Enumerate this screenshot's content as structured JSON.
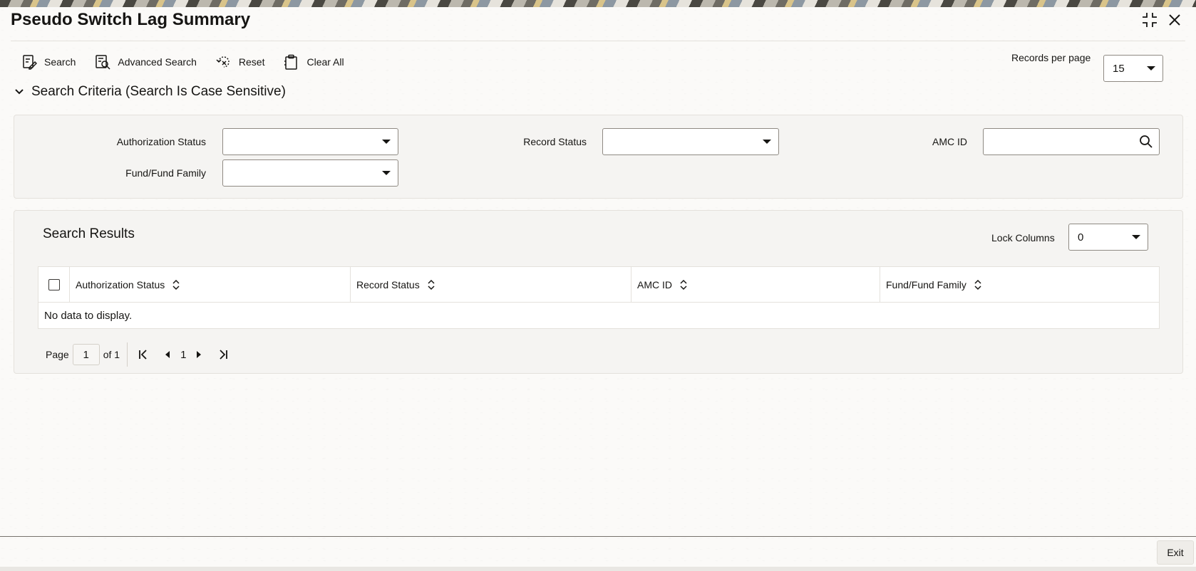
{
  "window": {
    "title": "Pseudo Switch Lag Summary"
  },
  "toolbar": {
    "search_label": "Search",
    "advanced_search_label": "Advanced Search",
    "reset_label": "Reset",
    "clear_all_label": "Clear All",
    "records_per_page_label": "Records per page",
    "records_per_page_value": "15"
  },
  "criteria": {
    "title": "Search Criteria (Search Is Case Sensitive)",
    "authorization_status_label": "Authorization Status",
    "authorization_status_value": "",
    "record_status_label": "Record Status",
    "record_status_value": "",
    "amc_id_label": "AMC ID",
    "amc_id_value": "",
    "fund_family_label": "Fund/Fund Family",
    "fund_family_value": ""
  },
  "results": {
    "title": "Search Results",
    "lock_columns_label": "Lock Columns",
    "lock_columns_value": "0",
    "columns": [
      "Authorization Status",
      "Record Status",
      "AMC ID",
      "Fund/Fund Family"
    ],
    "empty_message": "No data to display.",
    "pager": {
      "page_label": "Page",
      "page_value": "1",
      "of_label": "of 1",
      "current": "1"
    }
  },
  "footer": {
    "exit_label": "Exit"
  },
  "icons": {
    "search": "search-doc-icon",
    "advanced_search": "advanced-search-icon",
    "reset": "reset-icon",
    "clear_all": "clipboard-icon",
    "maximize": "maximize-icon",
    "close": "close-icon"
  }
}
